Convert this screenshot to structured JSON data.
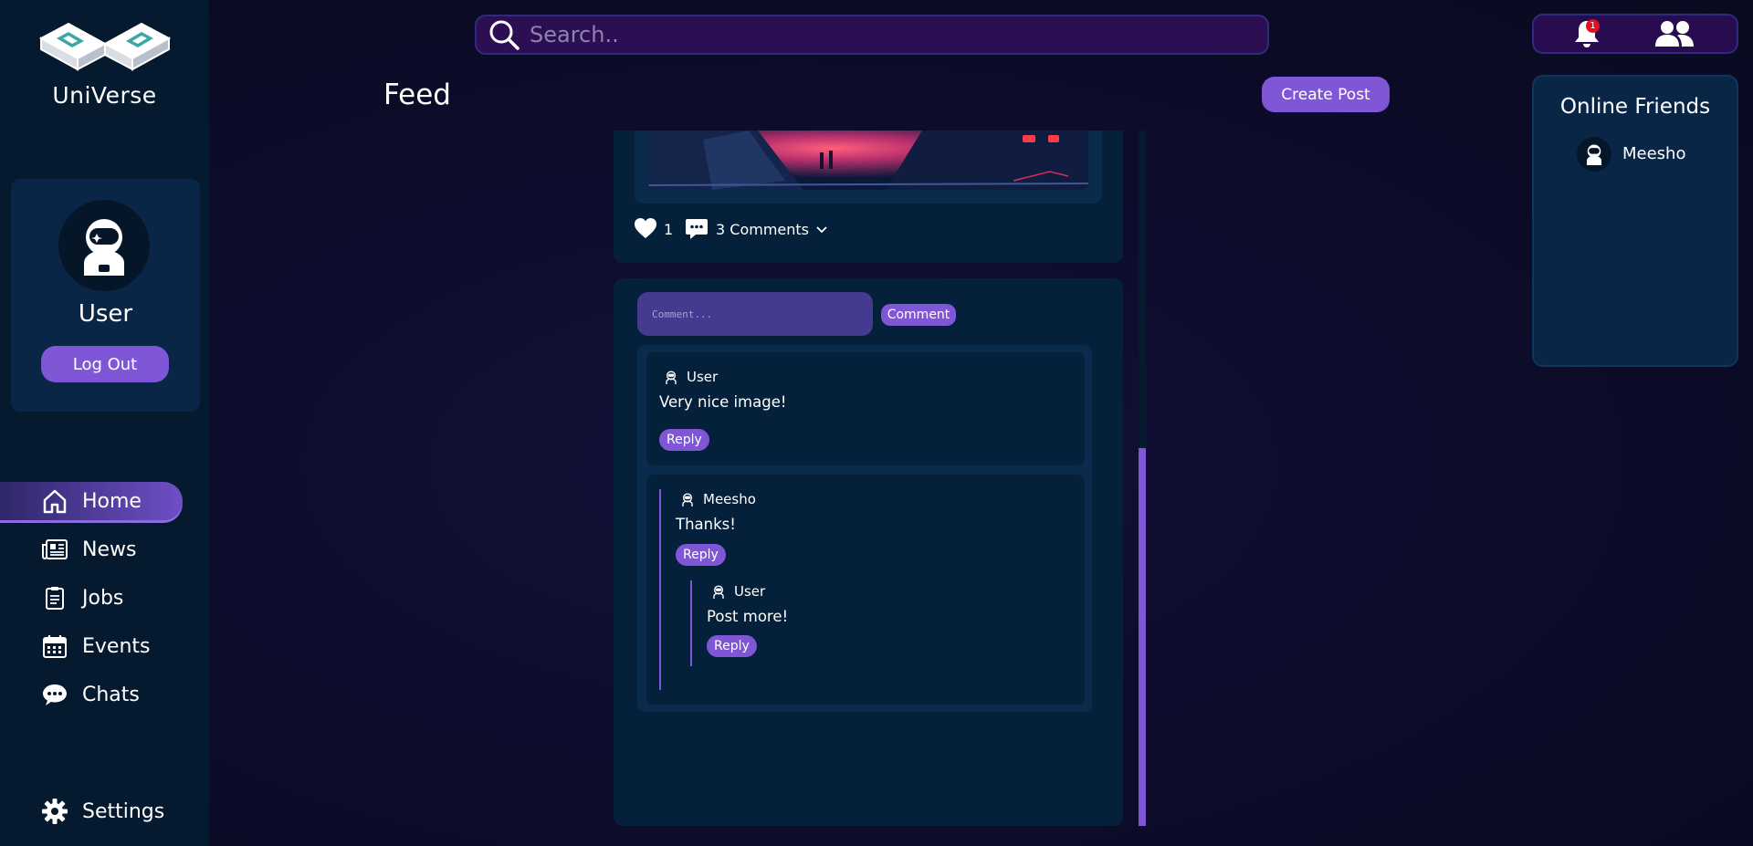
{
  "brand": {
    "name": "UniVerse"
  },
  "profile": {
    "username": "User",
    "logout_label": "Log Out"
  },
  "nav": {
    "items": [
      {
        "label": "Home",
        "icon": "home-icon",
        "active": true
      },
      {
        "label": "News",
        "icon": "news-icon",
        "active": false
      },
      {
        "label": "Jobs",
        "icon": "clipboard-icon",
        "active": false
      },
      {
        "label": "Events",
        "icon": "calendar-icon",
        "active": false
      },
      {
        "label": "Chats",
        "icon": "chat-bubble-icon",
        "active": false
      }
    ],
    "settings_label": "Settings"
  },
  "search": {
    "placeholder": "Search.."
  },
  "header": {
    "title": "Feed",
    "create_post_label": "Create Post"
  },
  "notifications": {
    "count": "1"
  },
  "online_friends": {
    "title": "Online Friends",
    "friends": [
      {
        "name": "Meesho"
      }
    ]
  },
  "post": {
    "likes": "1",
    "comments_label": "3 Comments"
  },
  "comment_form": {
    "placeholder": "Comment...",
    "submit_label": "Comment"
  },
  "comments": [
    {
      "user": "User",
      "text": "Very nice image!",
      "reply_label": "Reply"
    },
    {
      "user": "Meesho",
      "text": "Thanks!",
      "reply_label": "Reply",
      "replies": [
        {
          "user": "User",
          "text": "Post more!",
          "reply_label": "Reply"
        }
      ]
    }
  ],
  "colors": {
    "accent": "#7f57d6",
    "sidebar_bg": "#051a2f",
    "card_bg": "#04203a",
    "badge": "#e01020"
  }
}
